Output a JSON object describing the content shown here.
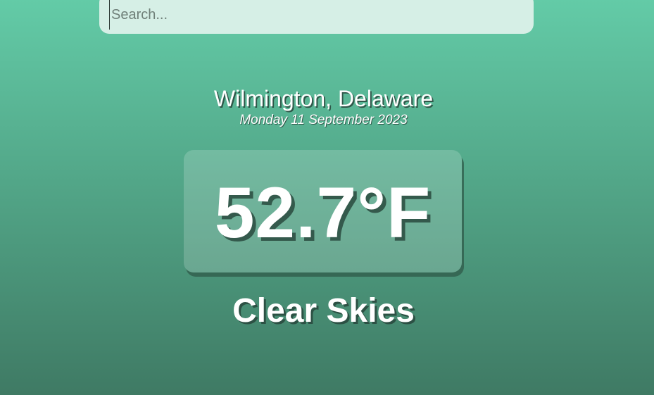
{
  "search": {
    "placeholder": "Search...",
    "value": ""
  },
  "weather": {
    "location": "Wilmington, Delaware",
    "date": "Monday 11 September 2023",
    "temperature": "52.7°F",
    "condition": "Clear Skies"
  },
  "colors": {
    "gradient_top": "#63cba7",
    "gradient_bottom": "#3f7a64",
    "search_bg": "#d6efe6",
    "text": "#ffffff"
  }
}
